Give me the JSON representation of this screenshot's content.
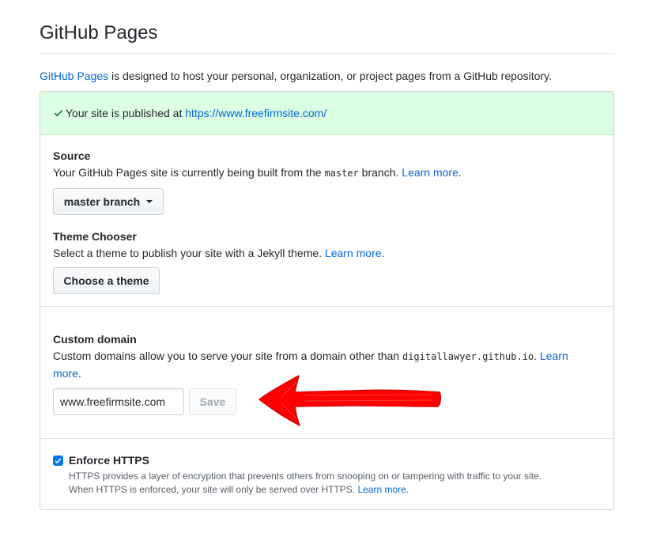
{
  "page": {
    "title": "GitHub Pages",
    "intro_link": "GitHub Pages",
    "intro_rest": " is designed to host your personal, organization, or project pages from a GitHub repository."
  },
  "flash": {
    "text": "Your site is published at ",
    "url": "https://www.freefirmsite.com/",
    "icon": "check-icon",
    "color": "#22863a"
  },
  "source": {
    "heading": "Source",
    "desc_before": "Your GitHub Pages site is currently being built from the ",
    "branch_code": "master",
    "desc_after": " branch. ",
    "learn_more": "Learn more",
    "period": ".",
    "branch_button": "master branch"
  },
  "theme": {
    "heading": "Theme Chooser",
    "desc": "Select a theme to publish your site with a Jekyll theme. ",
    "learn_more": "Learn more",
    "period": ".",
    "button": "Choose a theme"
  },
  "custom_domain": {
    "heading": "Custom domain",
    "desc_before": "Custom domains allow you to serve your site from a domain other than ",
    "domain_code": "digitallawyer.github.io",
    "desc_after": ". ",
    "learn": "Learn",
    "more": "more",
    "period": ".",
    "input_value": "www.freefirmsite.com",
    "save_button": "Save"
  },
  "https": {
    "label": "Enforce HTTPS",
    "checked": true,
    "note_line1": "HTTPS provides a layer of encryption that prevents others from snooping on or tampering with traffic to your site.",
    "note_line2": "When HTTPS is enforced, your site will only be served over HTTPS. ",
    "learn_more": "Learn more",
    "period": "."
  },
  "annotation": {
    "arrow_color": "#ff0000"
  }
}
